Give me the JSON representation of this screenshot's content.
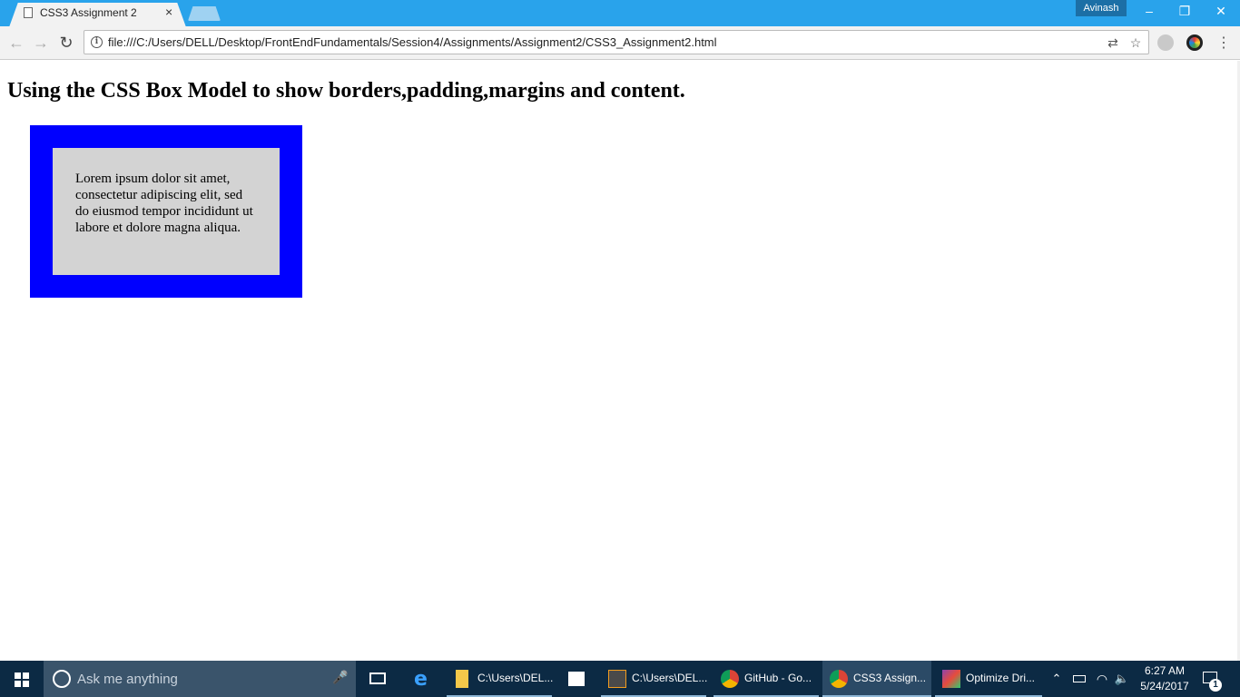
{
  "browser": {
    "tab_title": "CSS3 Assignment 2",
    "tab_close": "×",
    "profile_name": "Avinash",
    "window_controls": {
      "minimize": "–",
      "restore": "❐",
      "close": "✕"
    },
    "nav": {
      "back": "←",
      "forward": "→",
      "reload": "↻"
    },
    "info_glyph": "i",
    "url": "file:///C:/Users/DELL/Desktop/FrontEndFundamentals/Session4/Assignments/Assignment2/CSS3_Assignment2.html",
    "translate_glyph": "⇄",
    "bookmark_star": "☆",
    "menu": "⋮"
  },
  "page": {
    "heading": "Using the CSS Box Model to show borders,padding,margins and content.",
    "box_text": "Lorem ipsum dolor sit amet, consectetur adipiscing elit, sed do eiusmod tempor incididunt ut labore et dolore magna aliqua.",
    "colors": {
      "border": "#0000ff",
      "content_bg": "#d3d3d3"
    }
  },
  "taskbar": {
    "search_placeholder": "Ask me anything",
    "mic": "🎤",
    "items": [
      {
        "label": "C:\\Users\\DEL...",
        "icon": "file-explorer-icon"
      },
      {
        "label": "C:\\Users\\DEL...",
        "icon": "sublime-text-icon"
      },
      {
        "label": "GitHub - Go...",
        "icon": "chrome-icon"
      },
      {
        "label": "CSS3 Assign...",
        "icon": "chrome-icon"
      },
      {
        "label": "Optimize Dri...",
        "icon": "optimize-drives-icon"
      }
    ],
    "tray_chevron": "⌃",
    "time": "6:27 AM",
    "date": "5/24/2017",
    "notification_count": "1"
  }
}
